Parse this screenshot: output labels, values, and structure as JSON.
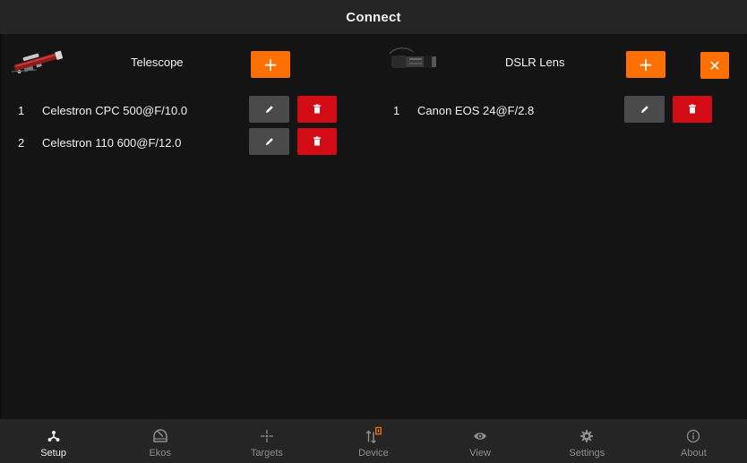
{
  "app": {
    "title": "Connect"
  },
  "colors": {
    "accent": "#ff7000",
    "danger": "#d30b14",
    "neutral_button": "#4a4a4a",
    "background": "#141414",
    "bar": "#252525"
  },
  "telescope_panel": {
    "title": "Telescope",
    "device_icon": "telescope-icon",
    "add_icon": "plus-icon",
    "items": [
      {
        "index": "1",
        "name": "Celestron CPC 500@F/10.0"
      },
      {
        "index": "2",
        "name": "Celestron 110 600@F/12.0"
      }
    ]
  },
  "lens_panel": {
    "title": "DSLR Lens",
    "device_icon": "dslr-lens-icon",
    "add_icon": "plus-icon",
    "close_icon": "close-icon",
    "items": [
      {
        "index": "1",
        "name": "Canon EOS 24@F/2.8"
      }
    ]
  },
  "row_actions": {
    "edit_icon": "pencil-icon",
    "delete_icon": "trash-icon"
  },
  "nav": {
    "active": "Setup",
    "items": [
      {
        "label": "Setup",
        "icon": "setup-icon"
      },
      {
        "label": "Ekos",
        "icon": "ekos-dome-icon"
      },
      {
        "label": "Targets",
        "icon": "targets-icon"
      },
      {
        "label": "Device",
        "icon": "device-icon"
      },
      {
        "label": "View",
        "icon": "eye-icon"
      },
      {
        "label": "Settings",
        "icon": "gear-icon"
      },
      {
        "label": "About",
        "icon": "info-icon"
      }
    ]
  }
}
